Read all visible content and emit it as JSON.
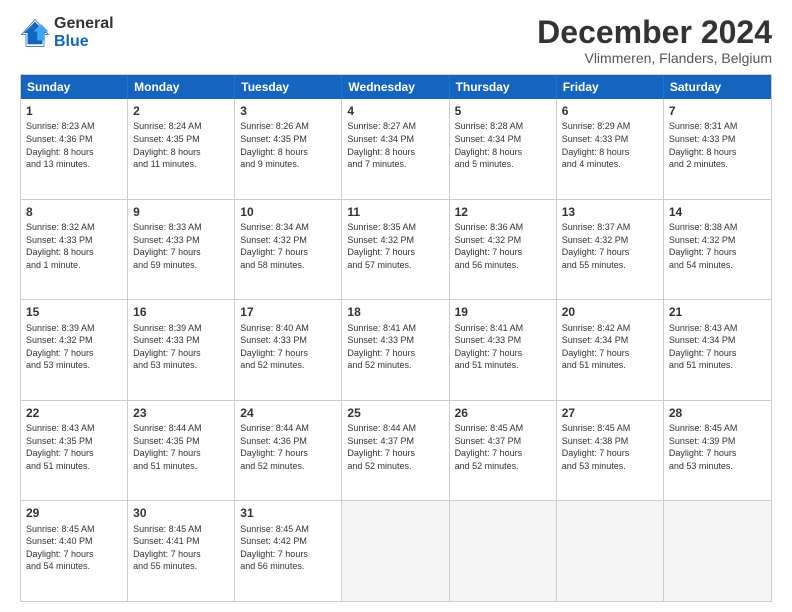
{
  "logo": {
    "line1": "General",
    "line2": "Blue"
  },
  "title": "December 2024",
  "subtitle": "Vlimmeren, Flanders, Belgium",
  "headers": [
    "Sunday",
    "Monday",
    "Tuesday",
    "Wednesday",
    "Thursday",
    "Friday",
    "Saturday"
  ],
  "weeks": [
    [
      {
        "day": "1",
        "text": "Sunrise: 8:23 AM\nSunset: 4:36 PM\nDaylight: 8 hours\nand 13 minutes."
      },
      {
        "day": "2",
        "text": "Sunrise: 8:24 AM\nSunset: 4:35 PM\nDaylight: 8 hours\nand 11 minutes."
      },
      {
        "day": "3",
        "text": "Sunrise: 8:26 AM\nSunset: 4:35 PM\nDaylight: 8 hours\nand 9 minutes."
      },
      {
        "day": "4",
        "text": "Sunrise: 8:27 AM\nSunset: 4:34 PM\nDaylight: 8 hours\nand 7 minutes."
      },
      {
        "day": "5",
        "text": "Sunrise: 8:28 AM\nSunset: 4:34 PM\nDaylight: 8 hours\nand 5 minutes."
      },
      {
        "day": "6",
        "text": "Sunrise: 8:29 AM\nSunset: 4:33 PM\nDaylight: 8 hours\nand 4 minutes."
      },
      {
        "day": "7",
        "text": "Sunrise: 8:31 AM\nSunset: 4:33 PM\nDaylight: 8 hours\nand 2 minutes."
      }
    ],
    [
      {
        "day": "8",
        "text": "Sunrise: 8:32 AM\nSunset: 4:33 PM\nDaylight: 8 hours\nand 1 minute."
      },
      {
        "day": "9",
        "text": "Sunrise: 8:33 AM\nSunset: 4:33 PM\nDaylight: 7 hours\nand 59 minutes."
      },
      {
        "day": "10",
        "text": "Sunrise: 8:34 AM\nSunset: 4:32 PM\nDaylight: 7 hours\nand 58 minutes."
      },
      {
        "day": "11",
        "text": "Sunrise: 8:35 AM\nSunset: 4:32 PM\nDaylight: 7 hours\nand 57 minutes."
      },
      {
        "day": "12",
        "text": "Sunrise: 8:36 AM\nSunset: 4:32 PM\nDaylight: 7 hours\nand 56 minutes."
      },
      {
        "day": "13",
        "text": "Sunrise: 8:37 AM\nSunset: 4:32 PM\nDaylight: 7 hours\nand 55 minutes."
      },
      {
        "day": "14",
        "text": "Sunrise: 8:38 AM\nSunset: 4:32 PM\nDaylight: 7 hours\nand 54 minutes."
      }
    ],
    [
      {
        "day": "15",
        "text": "Sunrise: 8:39 AM\nSunset: 4:32 PM\nDaylight: 7 hours\nand 53 minutes."
      },
      {
        "day": "16",
        "text": "Sunrise: 8:39 AM\nSunset: 4:33 PM\nDaylight: 7 hours\nand 53 minutes."
      },
      {
        "day": "17",
        "text": "Sunrise: 8:40 AM\nSunset: 4:33 PM\nDaylight: 7 hours\nand 52 minutes."
      },
      {
        "day": "18",
        "text": "Sunrise: 8:41 AM\nSunset: 4:33 PM\nDaylight: 7 hours\nand 52 minutes."
      },
      {
        "day": "19",
        "text": "Sunrise: 8:41 AM\nSunset: 4:33 PM\nDaylight: 7 hours\nand 51 minutes."
      },
      {
        "day": "20",
        "text": "Sunrise: 8:42 AM\nSunset: 4:34 PM\nDaylight: 7 hours\nand 51 minutes."
      },
      {
        "day": "21",
        "text": "Sunrise: 8:43 AM\nSunset: 4:34 PM\nDaylight: 7 hours\nand 51 minutes."
      }
    ],
    [
      {
        "day": "22",
        "text": "Sunrise: 8:43 AM\nSunset: 4:35 PM\nDaylight: 7 hours\nand 51 minutes."
      },
      {
        "day": "23",
        "text": "Sunrise: 8:44 AM\nSunset: 4:35 PM\nDaylight: 7 hours\nand 51 minutes."
      },
      {
        "day": "24",
        "text": "Sunrise: 8:44 AM\nSunset: 4:36 PM\nDaylight: 7 hours\nand 52 minutes."
      },
      {
        "day": "25",
        "text": "Sunrise: 8:44 AM\nSunset: 4:37 PM\nDaylight: 7 hours\nand 52 minutes."
      },
      {
        "day": "26",
        "text": "Sunrise: 8:45 AM\nSunset: 4:37 PM\nDaylight: 7 hours\nand 52 minutes."
      },
      {
        "day": "27",
        "text": "Sunrise: 8:45 AM\nSunset: 4:38 PM\nDaylight: 7 hours\nand 53 minutes."
      },
      {
        "day": "28",
        "text": "Sunrise: 8:45 AM\nSunset: 4:39 PM\nDaylight: 7 hours\nand 53 minutes."
      }
    ],
    [
      {
        "day": "29",
        "text": "Sunrise: 8:45 AM\nSunset: 4:40 PM\nDaylight: 7 hours\nand 54 minutes."
      },
      {
        "day": "30",
        "text": "Sunrise: 8:45 AM\nSunset: 4:41 PM\nDaylight: 7 hours\nand 55 minutes."
      },
      {
        "day": "31",
        "text": "Sunrise: 8:45 AM\nSunset: 4:42 PM\nDaylight: 7 hours\nand 56 minutes."
      },
      {
        "day": "",
        "text": ""
      },
      {
        "day": "",
        "text": ""
      },
      {
        "day": "",
        "text": ""
      },
      {
        "day": "",
        "text": ""
      }
    ]
  ]
}
